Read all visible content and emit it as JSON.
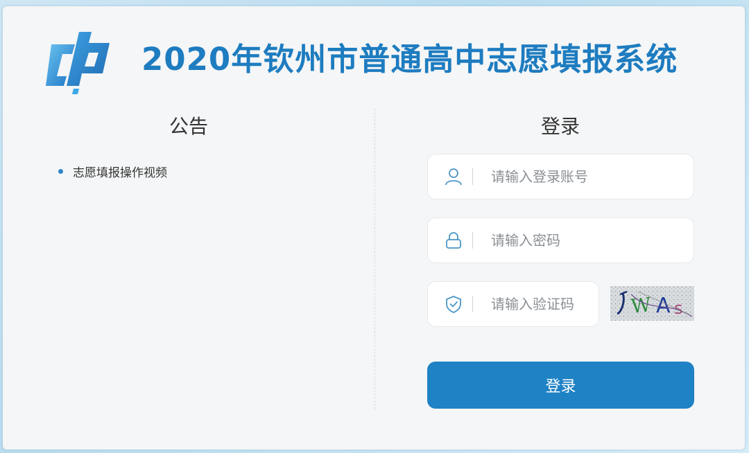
{
  "header": {
    "title": "2020年钦州市普通高中志愿填报系统",
    "logo_icon": "system-logo-icon"
  },
  "notice": {
    "title": "公告",
    "items": [
      {
        "label": "志愿填报操作视频"
      }
    ]
  },
  "login": {
    "title": "登录",
    "account": {
      "placeholder": "请输入登录账号",
      "value": "",
      "icon": "user-icon"
    },
    "password": {
      "placeholder": "请输入密码",
      "value": "",
      "icon": "lock-icon"
    },
    "captcha": {
      "placeholder": "请输入验证码",
      "value": "",
      "icon": "shield-check-icon",
      "image_text": "JWAs"
    },
    "submit_label": "登录"
  },
  "colors": {
    "brand": "#1e7cc0",
    "button": "#1f82c5",
    "background": "#f5f6f7",
    "icon": "#4a96c4"
  }
}
